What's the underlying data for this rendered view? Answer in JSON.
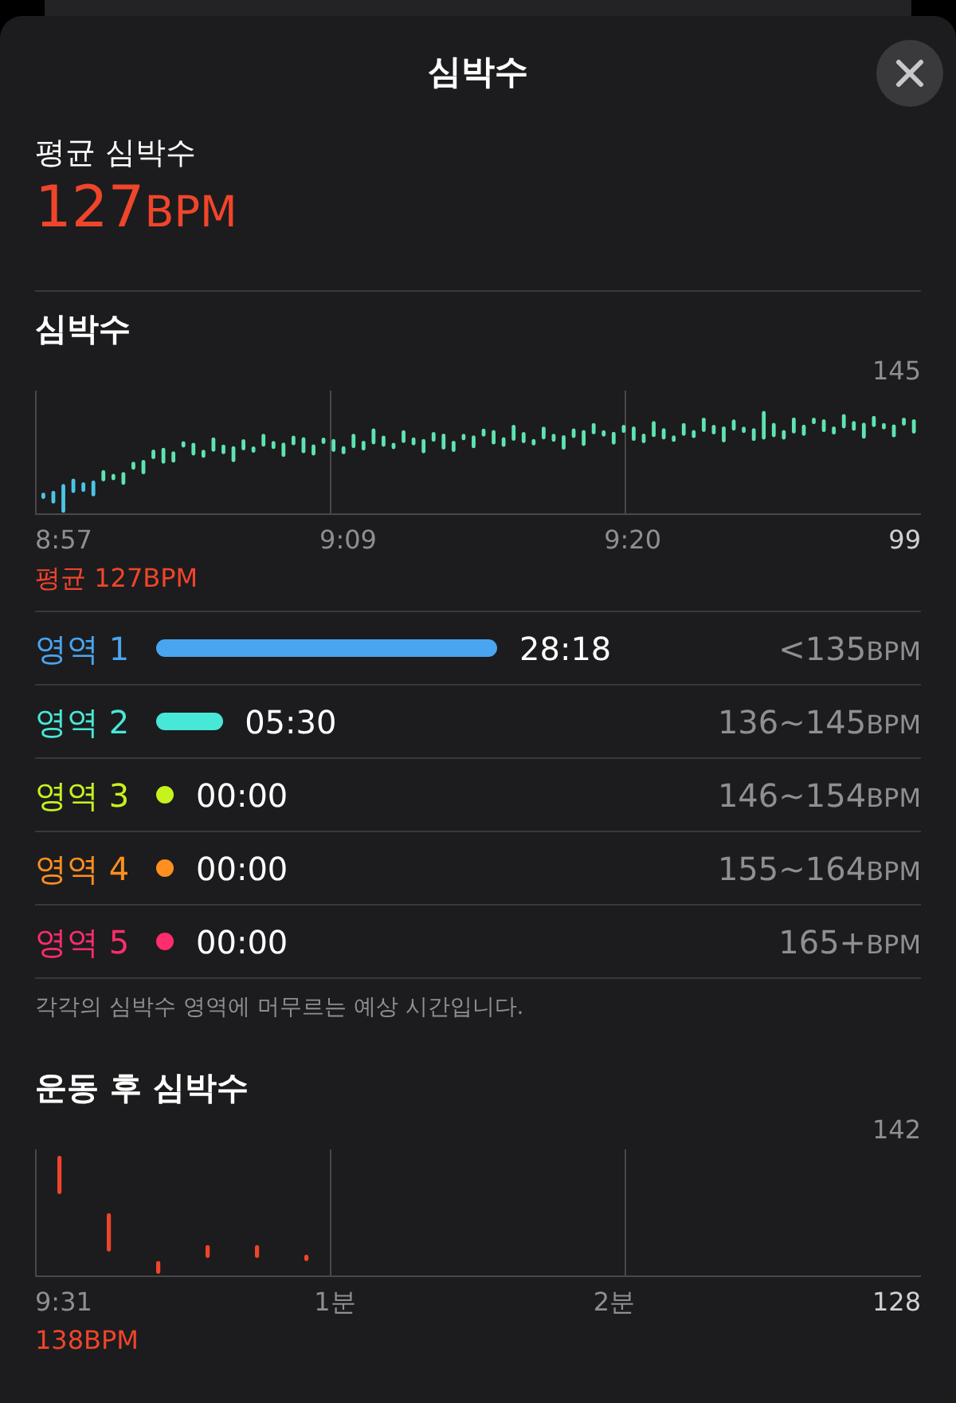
{
  "title": "심박수",
  "average": {
    "label": "평균 심박수",
    "value": "127",
    "unit": "BPM"
  },
  "heart_rate": {
    "heading": "심박수",
    "y_max": "145",
    "y_min": "99",
    "x_labels": [
      "8:57",
      "9:09",
      "9:20"
    ],
    "average": "평균 127BPM"
  },
  "zones": [
    {
      "name": "영역 1",
      "color": "#4aa5f0",
      "time": "28:18",
      "range": "<135",
      "unit": "BPM"
    },
    {
      "name": "영역 2",
      "color": "#48e8d8",
      "time": "05:30",
      "range": "136~145",
      "unit": "BPM"
    },
    {
      "name": "영역 3",
      "color": "#c6f21e",
      "time": "00:00",
      "range": "146~154",
      "unit": "BPM"
    },
    {
      "name": "영역 4",
      "color": "#ff8f1f",
      "time": "00:00",
      "range": "155~164",
      "unit": "BPM"
    },
    {
      "name": "영역 5",
      "color": "#ff2d6c",
      "time": "00:00",
      "range": "165+",
      "unit": "BPM"
    }
  ],
  "zones_note": "각각의 심박수 영역에 머무르는 예상 시간입니다.",
  "recovery": {
    "heading": "운동 후 심박수",
    "y_max": "142",
    "y_min": "128",
    "x_labels": [
      "9:31",
      "1분",
      "2분"
    ],
    "value": "138",
    "unit": "BPM"
  }
}
